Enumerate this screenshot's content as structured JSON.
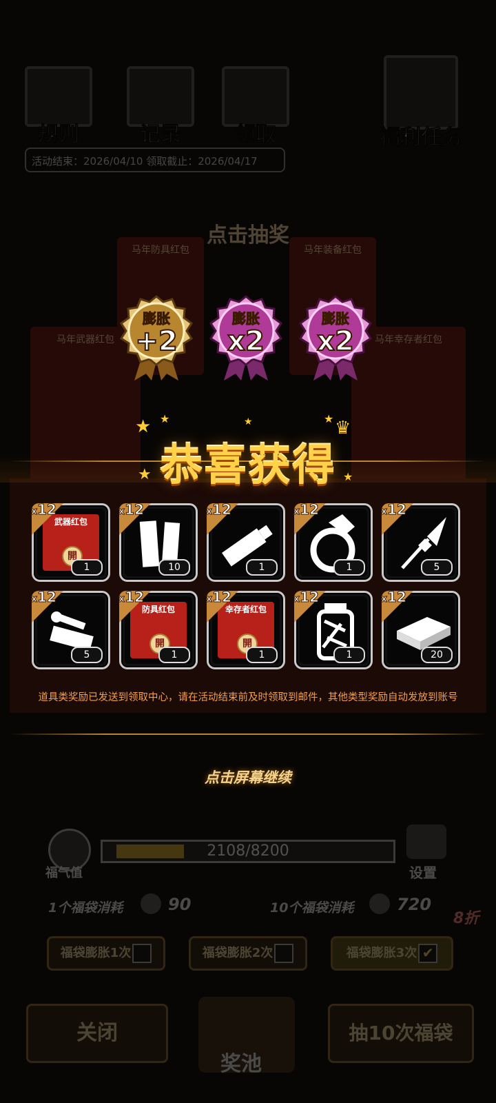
{
  "top_menu": {
    "rules": "规则",
    "records": "记录",
    "claim": "领取",
    "welfare_tasks": "福利任务",
    "date_info": "活动结束：2026/04/10  领取截止：2026/04/17"
  },
  "background": {
    "draw_hint": "点击抽奖",
    "card_left_top": "马年防具红包",
    "card_right_top": "马年装备红包",
    "card_left": "马年武器红包",
    "card_right": "马年幸存者红包",
    "seal": "開"
  },
  "medals": [
    {
      "label": "膨胀",
      "value": "+2",
      "color": "gold"
    },
    {
      "label": "膨胀",
      "value": "x2",
      "color": "purple"
    },
    {
      "label": "膨胀",
      "value": "x2",
      "color": "purple"
    }
  ],
  "reward_title": "恭喜获得",
  "items": [
    {
      "icon": "weapon-red-packet-icon",
      "name": "武器红包",
      "multiplier": "12",
      "count": "1"
    },
    {
      "icon": "bandage-strips-icon",
      "name": "",
      "multiplier": "12",
      "count": "10"
    },
    {
      "icon": "glue-tube-icon",
      "name": "",
      "multiplier": "12",
      "count": "1"
    },
    {
      "icon": "ring-icon",
      "name": "",
      "multiplier": "12",
      "count": "1"
    },
    {
      "icon": "rocket-lance-icon",
      "name": "",
      "multiplier": "12",
      "count": "5"
    },
    {
      "icon": "parts-pile-icon",
      "name": "",
      "multiplier": "12",
      "count": "5"
    },
    {
      "icon": "armor-red-packet-icon",
      "name": "防具红包",
      "multiplier": "12",
      "count": "1"
    },
    {
      "icon": "survivor-red-packet-icon",
      "name": "幸存者红包",
      "multiplier": "12",
      "count": "1"
    },
    {
      "icon": "jar-icon",
      "name": "",
      "multiplier": "12",
      "count": "1"
    },
    {
      "icon": "cash-bundle-icon",
      "name": "",
      "multiplier": "12",
      "count": "20"
    }
  ],
  "multiplier_prefix": "x",
  "notice": "道具类奖励已发送到领取中心，请在活动结束前及时领取到邮件，其他类型奖励自动发放到账号",
  "tap_continue": "点击屏幕继续",
  "luck": {
    "label": "福气值",
    "progress_text": "2108/8200",
    "progress_fraction": 0.257,
    "settings": "设置"
  },
  "cost": {
    "single": "1个福袋消耗",
    "single_value": "90",
    "ten": "10个福袋消耗",
    "ten_value": "720",
    "discount": "8折",
    "coin_label": "福气值"
  },
  "expand_options": [
    {
      "label": "福袋膨胀1次",
      "checked": false
    },
    {
      "label": "福袋膨胀2次",
      "checked": false
    },
    {
      "label": "福袋膨胀3次",
      "checked": true
    }
  ],
  "bottom": {
    "close": "关闭",
    "pool": "奖池",
    "draw10": "抽10次福袋"
  }
}
